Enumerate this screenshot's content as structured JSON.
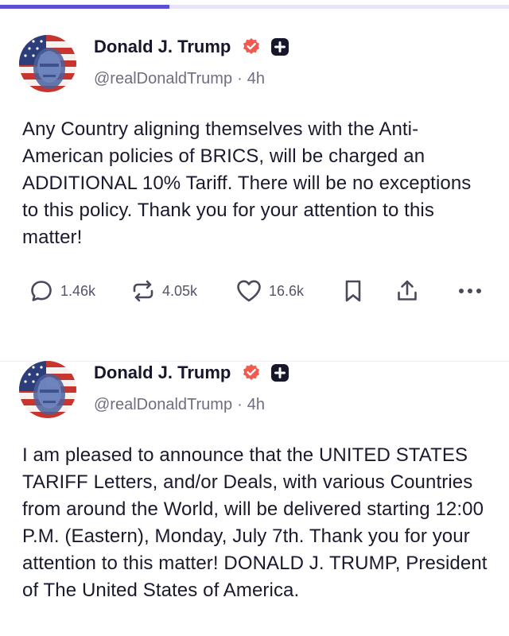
{
  "progress": {
    "fraction": 0.333,
    "fill_color": "#5b4fd6",
    "track_color": "#e6e4f6"
  },
  "icons": {
    "reply": "speech-bubble-icon",
    "repost": "repost-arrows-icon",
    "like": "heart-icon",
    "bookmark": "bookmark-icon",
    "share": "share-upload-icon",
    "more": "more-dots-icon",
    "verified": "verified-badge-icon",
    "plus": "plus-box-icon"
  },
  "colors": {
    "verified_badge": "#f05a4f",
    "text": "#1a1a2e",
    "muted": "#6e6e80"
  },
  "posts": [
    {
      "author_name": "Donald J. Trump",
      "handle": "@realDonaldTrump",
      "separator": "·",
      "time": "4h",
      "text": "Any Country aligning themselves with the Anti-American policies of BRICS, will be charged an ADDITIONAL 10% Tariff. There will be no exceptions to this policy. Thank you for your attention to this matter!",
      "replies": "1.46k",
      "reposts": "4.05k",
      "likes": "16.6k"
    },
    {
      "author_name": "Donald J. Trump",
      "handle": "@realDonaldTrump",
      "separator": "·",
      "time": "4h",
      "text": "I am pleased to announce that the UNITED STATES TARIFF Letters, and/or Deals, with various Countries from around the World, will be delivered starting 12:00 P.M. (Eastern), Monday, July 7th. Thank you for your attention to this matter! DONALD J. TRUMP, President of The United States of America."
    }
  ]
}
